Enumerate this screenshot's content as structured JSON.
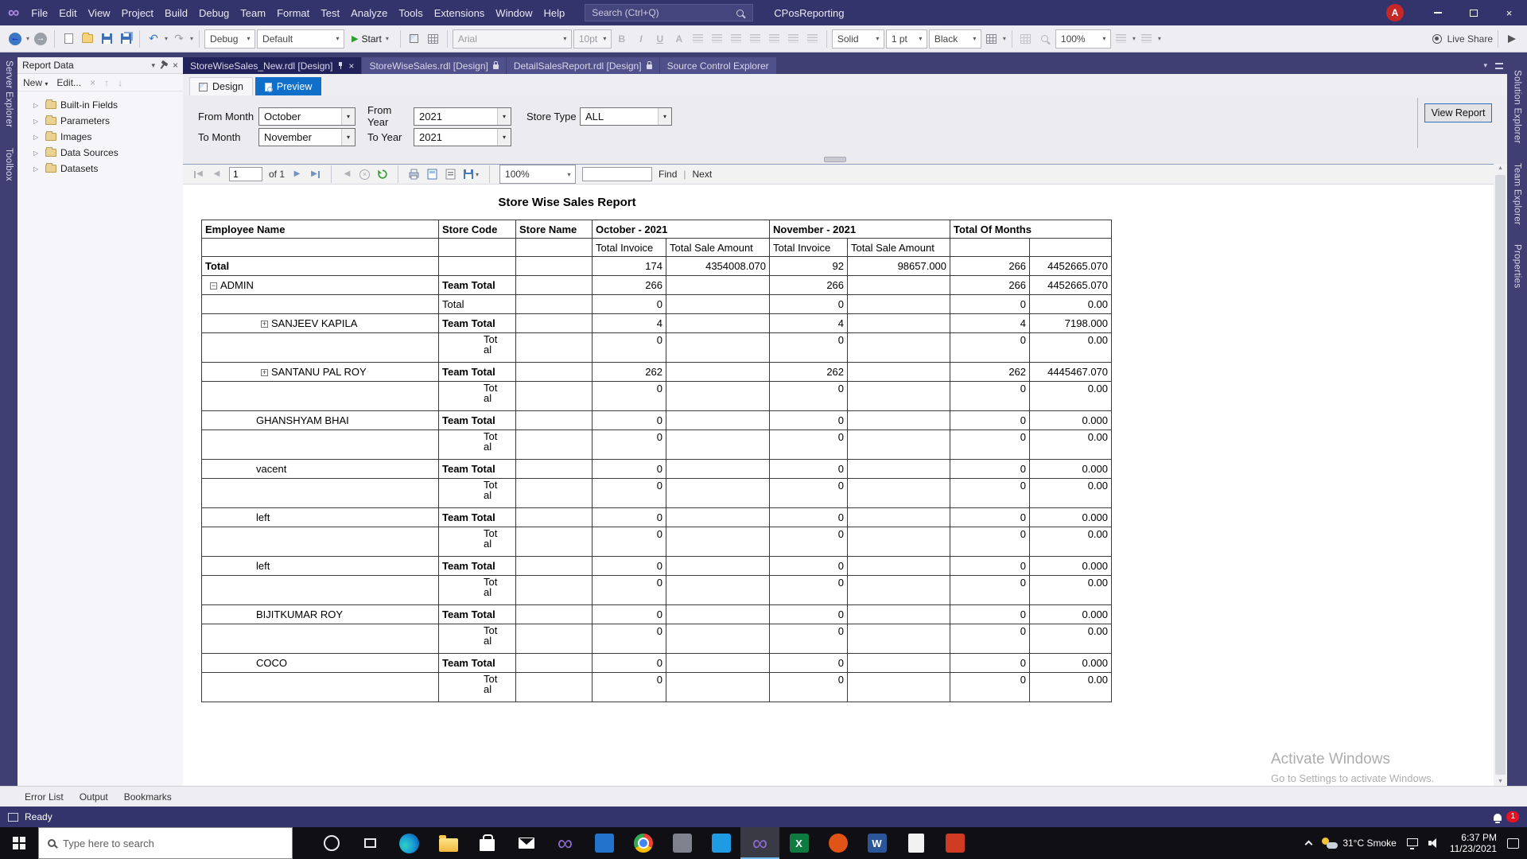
{
  "icons": {
    "close": "×",
    "caret_down": "▾",
    "expander": "▷",
    "plus": "+",
    "minus": "−",
    "up_arrow": "▲",
    "down_arrow": "▼",
    "left_tri": "◀",
    "right_tri": "▶",
    "back_arrow": "←",
    "forward_arrow": "→",
    "undo": "↶",
    "redo": "↷"
  },
  "titlebar": {
    "menus": [
      "File",
      "Edit",
      "View",
      "Project",
      "Build",
      "Debug",
      "Team",
      "Format",
      "Test",
      "Analyze",
      "Tools",
      "Extensions",
      "Window",
      "Help"
    ],
    "search_placeholder": "Search (Ctrl+Q)",
    "project_name": "CPosReporting",
    "avatar_letter": "A"
  },
  "toolbar": {
    "debug_combo": "Debug",
    "config_combo": "Default",
    "start_label": "Start",
    "font_combo": "Arial",
    "font_size_combo": "10pt",
    "bold_label": "B",
    "italic_label": "I",
    "underline_label": "U",
    "color_label": "A",
    "border_style_combo": "Solid",
    "border_width_combo": "1 pt",
    "border_color_combo": "Black",
    "zoom_combo": "100%",
    "live_share_label": "Live Share"
  },
  "left_strip": [
    "Server Explorer",
    "Toolbox"
  ],
  "right_strip": [
    "Solution Explorer",
    "Team Explorer",
    "Properties"
  ],
  "bottom_tabs": [
    "Error List",
    "Output",
    "Bookmarks"
  ],
  "report_data_panel": {
    "title": "Report Data",
    "new_label": "New",
    "edit_label": "Edit...",
    "items": [
      "Built-in Fields",
      "Parameters",
      "Images",
      "Data Sources",
      "Datasets"
    ]
  },
  "doc_tabs": [
    {
      "label": "StoreWiseSales_New.rdl [Design]",
      "active": true,
      "pin": true,
      "close": true
    },
    {
      "label": "StoreWiseSales.rdl [Design]",
      "lock": true
    },
    {
      "label": "DetailSalesReport.rdl [Design]",
      "lock": true
    },
    {
      "label": "Source Control Explorer"
    }
  ],
  "view_tabs": {
    "design": "Design",
    "preview": "Preview"
  },
  "parameters": {
    "from_month_label": "From Month",
    "from_month": "October",
    "from_year_label": "From Year",
    "from_year": "2021",
    "store_type_label": "Store Type",
    "store_type": "ALL",
    "to_month_label": "To Month",
    "to_month": "November",
    "to_year_label": "To Year",
    "to_year": "2021",
    "view_report_label": "View Report"
  },
  "viewer_toolbar": {
    "page": "1",
    "of_label": "of 1",
    "zoom": "100%",
    "find_label": "Find",
    "next_label": "Next"
  },
  "report": {
    "title": "Store Wise Sales Report",
    "header": {
      "groups": [
        {
          "label": "Employee Name",
          "span": 1
        },
        {
          "label": "Store Code",
          "span": 1
        },
        {
          "label": "Store Name",
          "span": 1
        },
        {
          "label": "October - 2021",
          "span": 2
        },
        {
          "label": "November - 2021",
          "span": 2
        },
        {
          "label": "Total Of Months",
          "span": 2
        }
      ],
      "sub": [
        "",
        "",
        "",
        "Total Invoice",
        "Total Sale Amount",
        "Total Invoice",
        "Total Sale Amount",
        "",
        ""
      ]
    },
    "rows": [
      {
        "style": "grand",
        "name": "Total",
        "sub": "",
        "v": [
          "174",
          "4354008.070",
          "92",
          "98657.000",
          "266",
          "4452665.070"
        ]
      },
      {
        "style": "team",
        "expander": "minus",
        "indent": 1,
        "name": "ADMIN",
        "sub": "Team Total",
        "v": [
          "266",
          "",
          "266",
          "",
          "266",
          "4452665.070"
        ]
      },
      {
        "style": "sub",
        "sub": "Total",
        "v": [
          "0",
          "",
          "0",
          "",
          "0",
          "0.00"
        ]
      },
      {
        "style": "team",
        "expander": "plus",
        "indent": 2,
        "name": "SANJEEV KAPILA",
        "sub": "Team Total",
        "v": [
          "4",
          "",
          "4",
          "",
          "4",
          "7198.000"
        ]
      },
      {
        "style": "subwrap",
        "sub": "Tot al",
        "v": [
          "0",
          "",
          "0",
          "",
          "0",
          "0.00"
        ]
      },
      {
        "style": "team",
        "expander": "plus",
        "indent": 2,
        "name": "SANTANU PAL ROY",
        "sub": "Team Total",
        "v": [
          "262",
          "",
          "262",
          "",
          "262",
          "4445467.070"
        ]
      },
      {
        "style": "subwrap",
        "sub": "Tot al",
        "v": [
          "0",
          "",
          "0",
          "",
          "0",
          "0.00"
        ]
      },
      {
        "style": "team",
        "indent": 2,
        "name": "GHANSHYAM BHAI",
        "sub": "Team Total",
        "v": [
          "0",
          "",
          "0",
          "",
          "0",
          "0.000"
        ]
      },
      {
        "style": "subwrap",
        "sub": "Tot al",
        "v": [
          "0",
          "",
          "0",
          "",
          "0",
          "0.00"
        ]
      },
      {
        "style": "team",
        "indent": 2,
        "name": "vacent",
        "sub": "Team Total",
        "v": [
          "0",
          "",
          "0",
          "",
          "0",
          "0.000"
        ]
      },
      {
        "style": "subwrap",
        "sub": "Tot al",
        "v": [
          "0",
          "",
          "0",
          "",
          "0",
          "0.00"
        ]
      },
      {
        "style": "team",
        "indent": 2,
        "name": "left",
        "sub": "Team Total",
        "v": [
          "0",
          "",
          "0",
          "",
          "0",
          "0.000"
        ]
      },
      {
        "style": "subwrap",
        "sub": "Tot al",
        "v": [
          "0",
          "",
          "0",
          "",
          "0",
          "0.00"
        ]
      },
      {
        "style": "team",
        "indent": 2,
        "name": "left",
        "sub": "Team Total",
        "v": [
          "0",
          "",
          "0",
          "",
          "0",
          "0.000"
        ]
      },
      {
        "style": "subwrap",
        "sub": "Tot al",
        "v": [
          "0",
          "",
          "0",
          "",
          "0",
          "0.00"
        ]
      },
      {
        "style": "team",
        "indent": 2,
        "name": "BIJITKUMAR ROY",
        "sub": "Team Total",
        "v": [
          "0",
          "",
          "0",
          "",
          "0",
          "0.000"
        ]
      },
      {
        "style": "subwrap",
        "sub": "Tot al",
        "v": [
          "0",
          "",
          "0",
          "",
          "0",
          "0.00"
        ]
      },
      {
        "style": "team",
        "indent": 2,
        "name": "COCO",
        "sub": "Team Total",
        "v": [
          "0",
          "",
          "0",
          "",
          "0",
          "0.000"
        ]
      },
      {
        "style": "subwrap",
        "sub": "Tot al",
        "v": [
          "0",
          "",
          "0",
          "",
          "0",
          "0.00"
        ]
      }
    ]
  },
  "watermark": {
    "line1": "Activate Windows",
    "line2": "Go to Settings to activate Windows."
  },
  "status_bar": {
    "message": "Ready",
    "notification_count": "1"
  },
  "taskbar": {
    "search_placeholder": "Type here to search",
    "icons": [
      {
        "name": "cortana",
        "cls": "ic-cortana"
      },
      {
        "name": "task-view",
        "cls": "ic-taskview"
      },
      {
        "name": "microsoft-edge",
        "cls": "ic-edge"
      },
      {
        "name": "file-explorer",
        "cls": "ic-explorer"
      },
      {
        "name": "microsoft-store",
        "cls": "ic-store"
      },
      {
        "name": "mail",
        "cls": "ic-mail"
      },
      {
        "name": "visual-studio",
        "cls": "ic-vs",
        "glyph": "∞"
      },
      {
        "name": "blue-app",
        "cls": "ic-blueapp"
      },
      {
        "name": "google-chrome",
        "cls": "ic-chrome"
      },
      {
        "name": "gray-app",
        "cls": "ic-grayapp"
      },
      {
        "name": "vs-code",
        "cls": "ic-vscode"
      },
      {
        "name": "visual-studio-running",
        "cls": "ic-vs",
        "glyph": "∞",
        "active": true
      },
      {
        "name": "excel",
        "cls": "ic-excel",
        "glyph": "X"
      },
      {
        "name": "orange-app",
        "cls": "ic-orange"
      },
      {
        "name": "word",
        "cls": "ic-word",
        "glyph": "W"
      },
      {
        "name": "notepad",
        "cls": "ic-light"
      },
      {
        "name": "red-app",
        "cls": "ic-red"
      }
    ],
    "tray": {
      "weather": "31°C Smoke",
      "time": "6:37 PM",
      "date": "11/23/2021"
    }
  },
  "colors": {
    "titlebar": "#34346c",
    "preview_accent": "#1070c9",
    "value_link_blue": "#0000d2",
    "badge_red": "#e81123"
  }
}
